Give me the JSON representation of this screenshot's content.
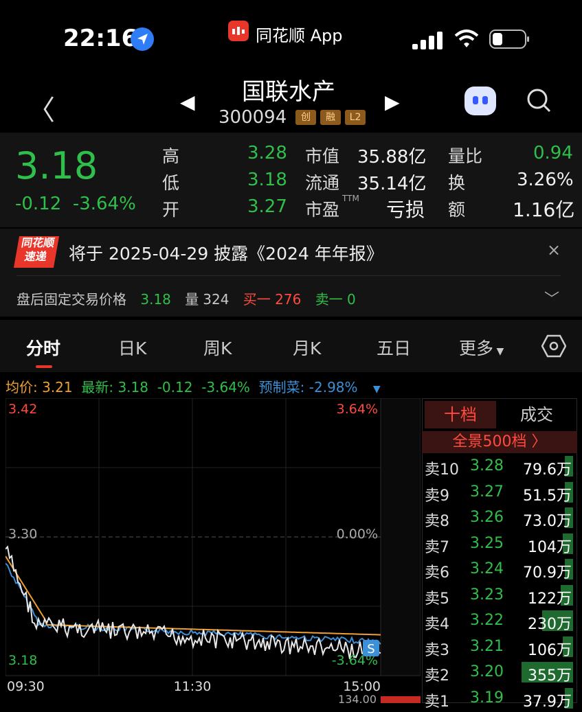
{
  "status_bar": {
    "time": "22:16",
    "app_label": "同花顺 App"
  },
  "header": {
    "name": "国联水产",
    "code": "300094",
    "tags": [
      "创",
      "融",
      "L2"
    ]
  },
  "quote": {
    "price": "3.18",
    "change": "-0.12",
    "change_pct": "-3.64%",
    "col1": [
      {
        "label": "高",
        "value": "3.28"
      },
      {
        "label": "低",
        "value": "3.18"
      },
      {
        "label": "开",
        "value": "3.27"
      }
    ],
    "col2": [
      {
        "label": "市值",
        "value": "35.88亿"
      },
      {
        "label": "流通",
        "value": "35.14亿"
      },
      {
        "label": "市盈",
        "sup": "TTM",
        "value": "亏损"
      }
    ],
    "col3": [
      {
        "label": "量比",
        "value": "0.94"
      },
      {
        "label": "换",
        "value": "3.26%"
      },
      {
        "label": "额",
        "value": "1.16亿"
      }
    ]
  },
  "news": {
    "logo_top": "同花顺",
    "logo_bottom": "速递",
    "text": "将于 2025-04-29 披露《2024 年年报》",
    "close": "×"
  },
  "after_hours": {
    "label": "盘后固定交易价格",
    "price": "3.18",
    "vol_label": "量",
    "vol": "324",
    "buy": "买一 276",
    "sell": "卖一 0"
  },
  "tabs": [
    "分时",
    "日K",
    "周K",
    "月K",
    "五日",
    "更多"
  ],
  "info_line": {
    "avg": "均价: 3.21",
    "latest": "最新: 3.18",
    "chg": "-0.12",
    "pct": "-3.64%",
    "forecast": "预制菜: -2.98%"
  },
  "chart_data": {
    "type": "line",
    "price_axis_labels": [
      "3.42",
      "3.30",
      "3.18"
    ],
    "pct_axis_labels": [
      "3.64%",
      "0.00%",
      "-3.64%"
    ],
    "time_labels": [
      "09:30",
      "11:30",
      "15:00"
    ],
    "ylim": [
      3.18,
      3.42
    ],
    "series": [
      {
        "name": "价格",
        "color": "#e8e8e8"
      },
      {
        "name": "均价",
        "color": "#f0a030"
      },
      {
        "name": "预制菜",
        "color": "#3d8fd6"
      }
    ],
    "marker": "S",
    "bottom_label": "134.00"
  },
  "order_book": {
    "tab_active": "十档",
    "tab": "成交",
    "panorama": "全景500档 〉",
    "rows": [
      {
        "label": "卖10",
        "price": "3.28",
        "vol": "79.6万",
        "level": 0.08
      },
      {
        "label": "卖9",
        "price": "3.27",
        "vol": "51.5万",
        "level": 0.06
      },
      {
        "label": "卖8",
        "price": "3.26",
        "vol": "73.0万",
        "level": 0.07
      },
      {
        "label": "卖7",
        "price": "3.25",
        "vol": "104万",
        "level": 0.1
      },
      {
        "label": "卖6",
        "price": "3.24",
        "vol": "70.9万",
        "level": 0.07
      },
      {
        "label": "卖5",
        "price": "3.23",
        "vol": "122万",
        "level": 0.12
      },
      {
        "label": "卖4",
        "price": "3.22",
        "vol": "230万",
        "level": 0.3
      },
      {
        "label": "卖3",
        "price": "3.21",
        "vol": "106万",
        "level": 0.1
      },
      {
        "label": "卖2",
        "price": "3.20",
        "vol": "355万",
        "level": 0.5
      },
      {
        "label": "卖1",
        "price": "3.19",
        "vol": "37.9万",
        "level": 0.05
      }
    ]
  }
}
